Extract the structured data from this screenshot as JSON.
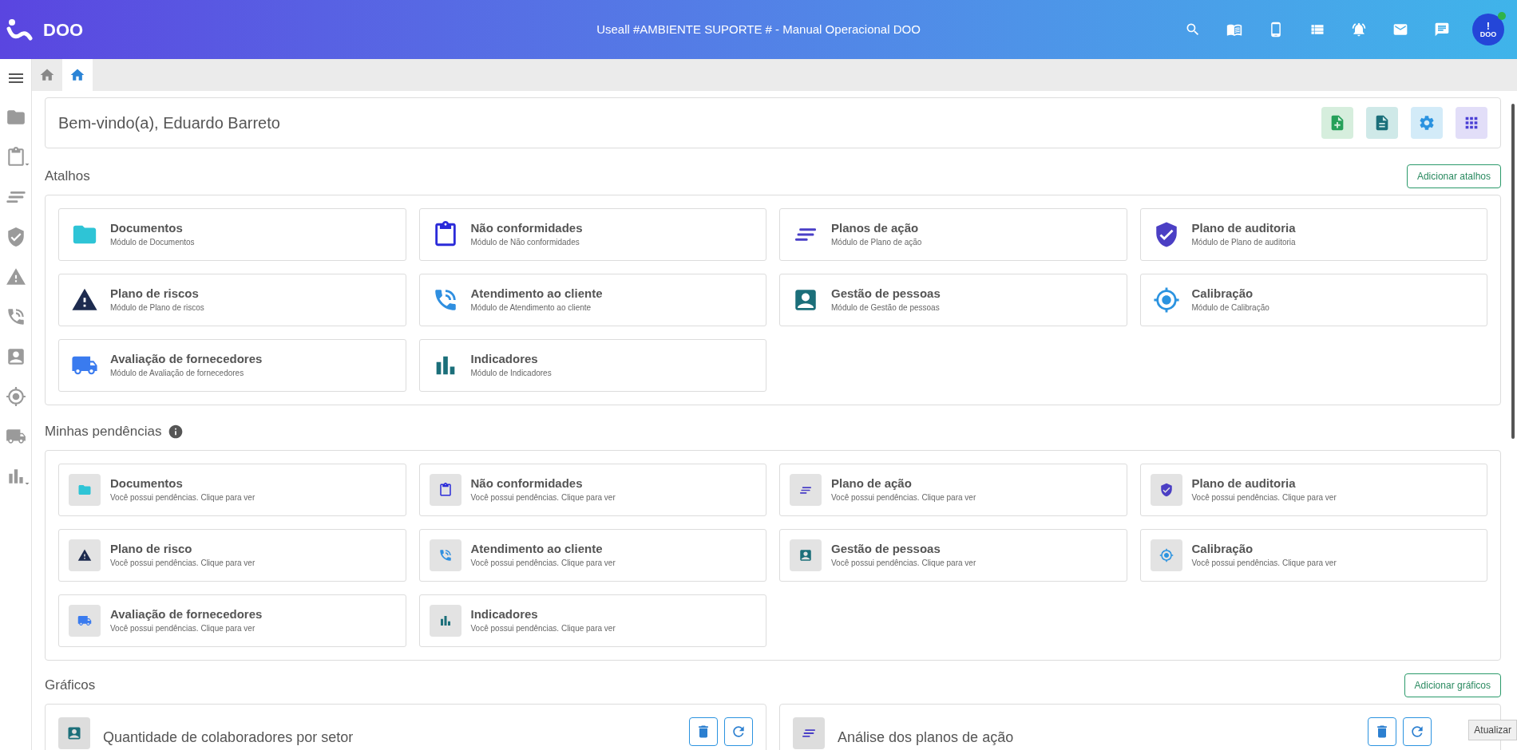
{
  "header": {
    "logo": "DOO",
    "title": "Useall #AMBIENTE SUPORTE # - Manual Operacional DOO",
    "avatar": {
      "mark": "!",
      "text": "DOO",
      "online": true
    }
  },
  "tabs": [
    {
      "selected": false
    },
    {
      "selected": true
    }
  ],
  "welcome": "Bem-vindo(a), Eduardo Barreto",
  "shortcuts": {
    "title": "Atalhos",
    "button": "Adicionar atalhos",
    "items": [
      {
        "title": "Documentos",
        "subtitle": "Módulo de Documentos"
      },
      {
        "title": "Não conformidades",
        "subtitle": "Módulo de Não conformidades"
      },
      {
        "title": "Planos de ação",
        "subtitle": "Módulo de Plano de ação"
      },
      {
        "title": "Plano de auditoria",
        "subtitle": "Módulo de Plano de auditoria"
      },
      {
        "title": "Plano de riscos",
        "subtitle": "Módulo de Plano de riscos"
      },
      {
        "title": "Atendimento ao cliente",
        "subtitle": "Módulo de Atendimento ao cliente"
      },
      {
        "title": "Gestão de pessoas",
        "subtitle": "Módulo de Gestão de pessoas"
      },
      {
        "title": "Calibração",
        "subtitle": "Módulo de Calibração"
      },
      {
        "title": "Avaliação de fornecedores",
        "subtitle": "Módulo de Avaliação de fornecedores"
      },
      {
        "title": "Indicadores",
        "subtitle": "Módulo de Indicadores"
      }
    ]
  },
  "pending": {
    "title": "Minhas pendências",
    "items": [
      {
        "title": "Documentos",
        "subtitle": "Você possui pendências. Clique para ver"
      },
      {
        "title": "Não conformidades",
        "subtitle": "Você possui pendências. Clique para ver"
      },
      {
        "title": "Plano de ação",
        "subtitle": "Você possui pendências. Clique para ver"
      },
      {
        "title": "Plano de auditoria",
        "subtitle": "Você possui pendências. Clique para ver"
      },
      {
        "title": "Plano de risco",
        "subtitle": "Você possui pendências. Clique para ver"
      },
      {
        "title": "Atendimento ao cliente",
        "subtitle": "Você possui pendências. Clique para ver"
      },
      {
        "title": "Gestão de pessoas",
        "subtitle": "Você possui pendências. Clique para ver"
      },
      {
        "title": "Calibração",
        "subtitle": "Você possui pendências. Clique para ver"
      },
      {
        "title": "Avaliação de fornecedores",
        "subtitle": "Você possui pendências. Clique para ver"
      },
      {
        "title": "Indicadores",
        "subtitle": "Você possui pendências. Clique para ver"
      }
    ]
  },
  "charts": {
    "title": "Gráficos",
    "button": "Adicionar gráficos",
    "items": [
      {
        "title": "Quantidade de colaboradores por setor"
      },
      {
        "title": "Análise dos planos de ação"
      }
    ]
  },
  "tooltip": "Atualizar"
}
